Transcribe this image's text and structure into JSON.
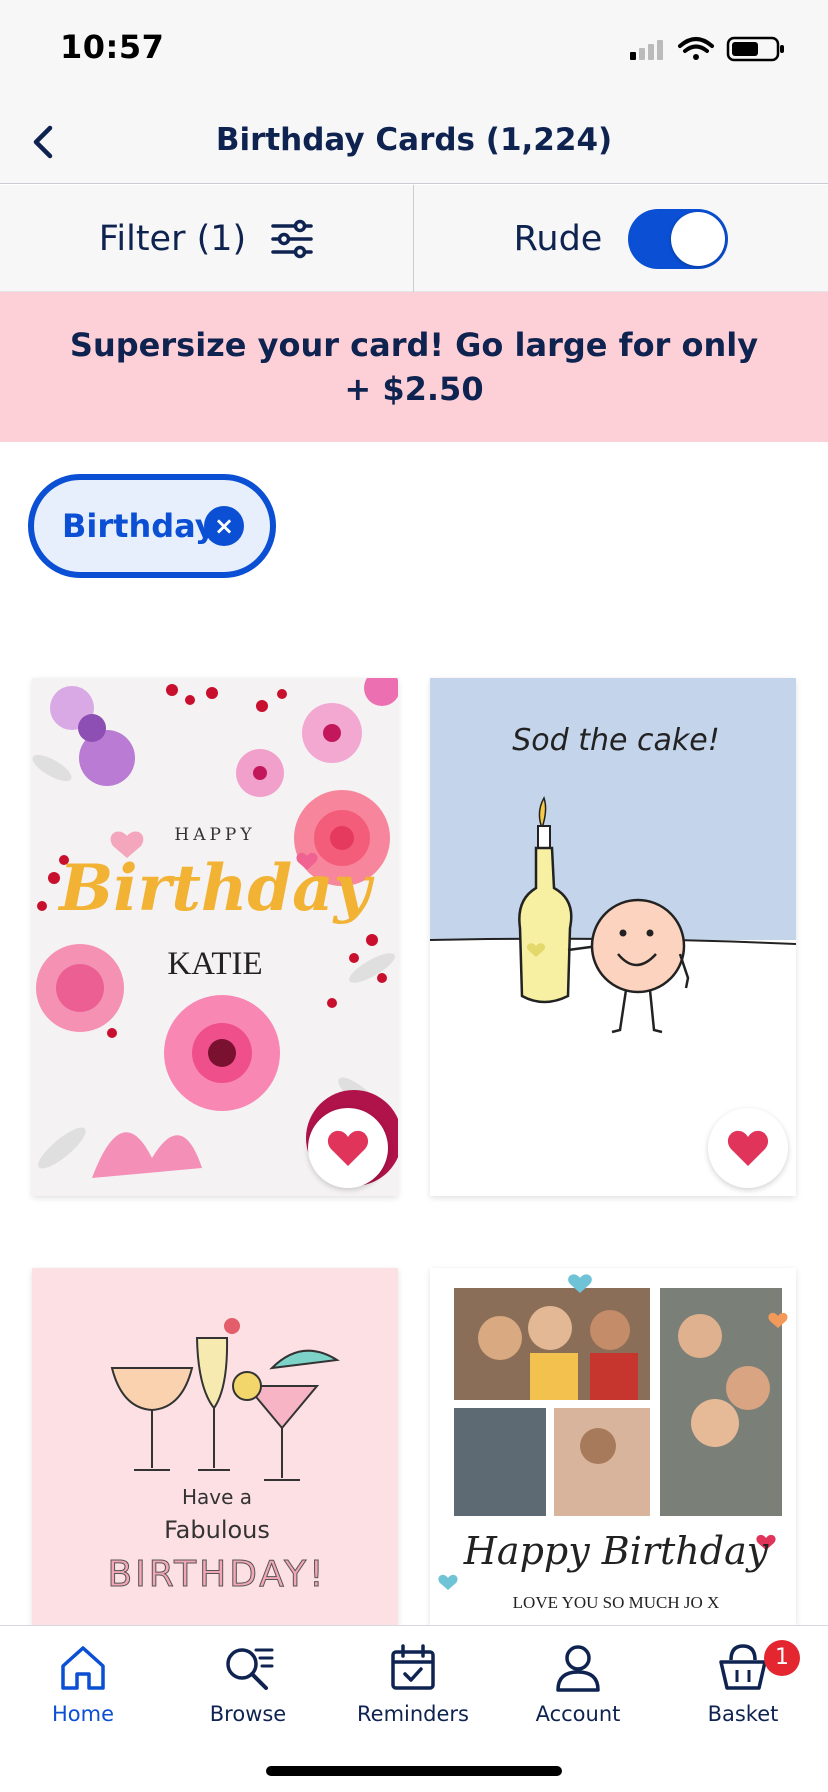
{
  "status_bar": {
    "time": "10:57"
  },
  "nav": {
    "title": "Birthday Cards (1,224)"
  },
  "filter": {
    "label": "Filter (1)"
  },
  "rude_toggle": {
    "label": "Rude",
    "on": true
  },
  "promo": {
    "text": "Supersize your card! Go large for only + $2.50"
  },
  "chips": [
    {
      "label": "Birthday"
    }
  ],
  "cards": [
    {
      "happy": "HAPPY",
      "script": "Birthday",
      "name": "KATIE",
      "favorited": true
    },
    {
      "caption": "Sod the cake!",
      "favorited": true
    },
    {
      "line1": "Have a",
      "line2": "Fabulous",
      "line3": "BIRTHDAY!"
    },
    {
      "script": "Happy Birthday",
      "message": "LOVE YOU SO MUCH JO X"
    }
  ],
  "tabs": [
    {
      "label": "Home",
      "icon": "home-icon",
      "active": true
    },
    {
      "label": "Browse",
      "icon": "browse-search-icon"
    },
    {
      "label": "Reminders",
      "icon": "calendar-icon"
    },
    {
      "label": "Account",
      "icon": "account-icon"
    },
    {
      "label": "Basket",
      "icon": "basket-icon",
      "badge": "1"
    }
  ],
  "colors": {
    "accent": "#0a4fd4",
    "navy": "#0f2350",
    "promo_bg": "#fdd0d8",
    "heart": "#e0345a"
  }
}
